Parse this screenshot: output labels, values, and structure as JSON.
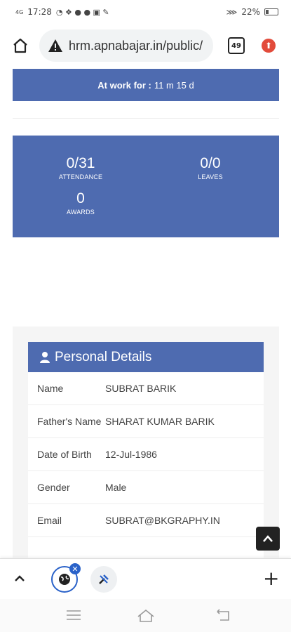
{
  "status_bar": {
    "signal": "4G",
    "time": "17:28",
    "battery": "22%"
  },
  "browser": {
    "url": "hrm.apnabajar.in/public/",
    "tab_count": "49",
    "icons": [
      "home-icon",
      "warning-icon",
      "tabs-icon",
      "update-icon"
    ]
  },
  "work": {
    "label": "At work for :",
    "value": "11 m 15 d"
  },
  "stats": {
    "attendance": {
      "value": "0/31",
      "label": "ATTENDANCE"
    },
    "leaves": {
      "value": "0/0",
      "label": "LEAVES"
    },
    "awards": {
      "value": "0",
      "label": "AWARDS"
    }
  },
  "personal": {
    "title": "Personal Details",
    "rows": [
      {
        "key": "Name",
        "value": "SUBRAT BARIK"
      },
      {
        "key": "Father's Name",
        "value": "SHARAT KUMAR BARIK"
      },
      {
        "key": "Date of Birth",
        "value": "12-Jul-1986"
      },
      {
        "key": "Gender",
        "value": "Male"
      },
      {
        "key": "Email",
        "value": "SUBRAT@BKGRAPHY.IN"
      }
    ]
  },
  "colors": {
    "panel_blue": "#4e6bb0",
    "tab_blue": "#2a62c9",
    "update_red": "#e24b3b"
  }
}
